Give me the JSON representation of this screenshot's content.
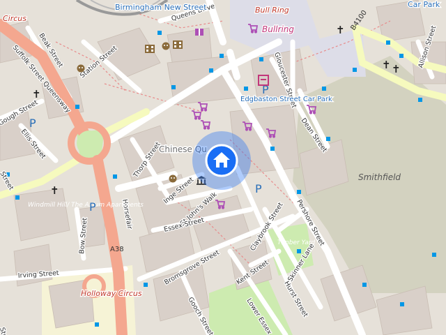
{
  "map": {
    "colors": {
      "background": "#e6e1d9",
      "building": "#d9d0c9",
      "park": "#c8d7ab",
      "grass": "#cdebb0",
      "market": "#d3d2c0",
      "road": "#ffffff",
      "trunk": "#f4a78f",
      "secondary": "#f6fabe",
      "pedestrian": "#dddde8",
      "bus_stop": "#0097e6",
      "location_marker": "#1a6ef5",
      "label_red": "#c0392b",
      "label_blue": "#2a6fb8",
      "label_pink": "#c2377a"
    },
    "street_labels": [
      "Queens Drive",
      "Suffolk Street Queensway",
      "Beak Street",
      "Station Street",
      "Gough Street",
      "Ellis Street",
      "Thorp Street",
      "Inge Street",
      "St John's Walk",
      "Essex Street",
      "Horsefair",
      "Bow Street",
      "Irving Street",
      "Bromsgrove Street",
      "Gooch Street",
      "Kent Street",
      "Lower Essex",
      "Hurst Street",
      "Skinner Lane",
      "Claybrook Street",
      "Pershore Street",
      "Dean Street",
      "Gloucester Street",
      "Allison Street",
      "Street",
      "Street"
    ],
    "road_refs": [
      "A38",
      "B4100"
    ],
    "places": {
      "birmingham_new_street": "Birmingham New Street",
      "bull_ring": "Bull Ring",
      "bullring": "Bullring",
      "edgbaston_car_park": "Edgbaston Street Car Park",
      "car_park": "Car Park",
      "smithfield": "Smithfield",
      "holloway_circus": "Holloway Circus",
      "circus": "Circus",
      "chinese_quarter": "Chinese Qu",
      "timber_yard": "Timber Yard",
      "windmill": "Windmill Hill/ The Axium Apartments"
    },
    "icons": {
      "marker": "home-icon",
      "parking": "parking-icon",
      "shop": "shop-icon",
      "theatre": "theatre-icon",
      "church": "church-icon",
      "museum": "museum-icon",
      "bus_stop": "bus-stop-icon",
      "gift": "gift-icon"
    },
    "glyphs": {
      "parking": "P",
      "church": "✝",
      "home": "⌂"
    }
  }
}
